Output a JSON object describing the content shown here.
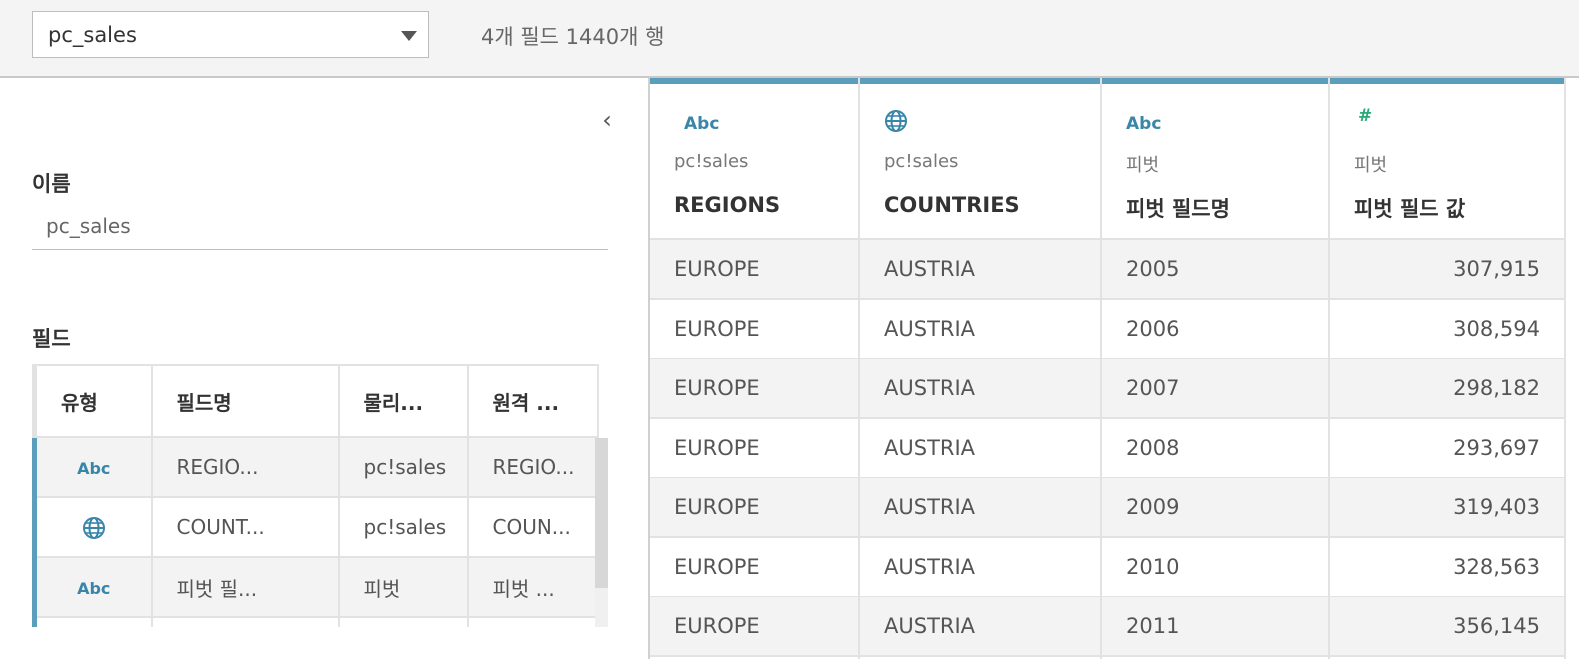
{
  "datasource": {
    "selected": "pc_sales"
  },
  "summary": "4개 필드 1440개 행",
  "left_panel": {
    "name_label": "이름",
    "name_value": "pc_sales",
    "fields_label": "필드",
    "columns": [
      "유형",
      "필드명",
      "물리...",
      "원격 ..."
    ],
    "rows": [
      {
        "type": "Abc",
        "field": "REGIO...",
        "physical": "pc!sales",
        "remote": "REGIO..."
      },
      {
        "type": "globe",
        "field": "COUNT...",
        "physical": "pc!sales",
        "remote": "COUN..."
      },
      {
        "type": "Abc",
        "field": "피벗 필...",
        "physical": "피벗",
        "remote": "피벗 ..."
      }
    ]
  },
  "grid": {
    "columns": [
      {
        "icon": "Abc",
        "source": "pc!sales",
        "name": "REGIONS"
      },
      {
        "icon": "globe",
        "source": "pc!sales",
        "name": "COUNTRIES"
      },
      {
        "icon": "Abc",
        "source": "피벗",
        "name": "피벗 필드명"
      },
      {
        "icon": "#",
        "source": "피벗",
        "name": "피벗 필드 값"
      }
    ],
    "rows": [
      [
        "EUROPE",
        "AUSTRIA",
        "2005",
        "307,915"
      ],
      [
        "EUROPE",
        "AUSTRIA",
        "2006",
        "308,594"
      ],
      [
        "EUROPE",
        "AUSTRIA",
        "2007",
        "298,182"
      ],
      [
        "EUROPE",
        "AUSTRIA",
        "2008",
        "293,697"
      ],
      [
        "EUROPE",
        "AUSTRIA",
        "2009",
        "319,403"
      ],
      [
        "EUROPE",
        "AUSTRIA",
        "2010",
        "328,563"
      ],
      [
        "EUROPE",
        "AUSTRIA",
        "2011",
        "356,145"
      ]
    ]
  },
  "colors": {
    "accent": "#5b9ebc",
    "string_icon": "#3a86a8",
    "number_icon": "#2aa876"
  }
}
